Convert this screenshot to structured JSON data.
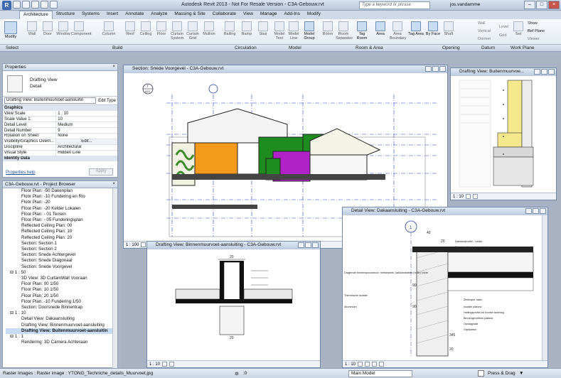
{
  "app": {
    "title": "Autodesk Revit 2013 - Not For Resale Version -    C3A-Gebouw.rvt",
    "search_placeholder": "Type a keyword or phrase",
    "user": "jos.vandamme"
  },
  "tabs": [
    "Architecture",
    "Structure",
    "Systems",
    "Insert",
    "Annotate",
    "Analyze",
    "Massing & Site",
    "Collaborate",
    "View",
    "Manage",
    "Add-Ins",
    "Modify"
  ],
  "ribbon": {
    "modify": "Modify",
    "tools": [
      {
        "label": "Wall",
        "on": false
      },
      {
        "label": "Door",
        "on": false
      },
      {
        "label": "Window",
        "on": false
      },
      {
        "label": "Component",
        "on": false
      },
      {
        "label": "Column",
        "on": false
      },
      {
        "label": "Roof",
        "on": false
      },
      {
        "label": "Ceiling",
        "on": false
      },
      {
        "label": "Floor",
        "on": false
      },
      {
        "label": "Curtain System",
        "on": false
      },
      {
        "label": "Curtain Grid",
        "on": false
      },
      {
        "label": "Mullion",
        "on": false
      },
      {
        "label": "Railing",
        "on": false
      },
      {
        "label": "Ramp",
        "on": false
      },
      {
        "label": "Stair",
        "on": false
      },
      {
        "label": "Model Text",
        "on": false
      },
      {
        "label": "Model Line",
        "on": false
      },
      {
        "label": "Model Group",
        "on": true
      },
      {
        "label": "Room",
        "on": false
      },
      {
        "label": "Room Separator",
        "on": false
      },
      {
        "label": "Tag Room",
        "on": true
      },
      {
        "label": "Area",
        "on": true
      },
      {
        "label": "Area Boundary",
        "on": false
      },
      {
        "label": "Tag Area",
        "on": true
      },
      {
        "label": "By Face",
        "on": true
      },
      {
        "label": "Shaft",
        "on": false
      }
    ],
    "opening_small": [
      "Wall",
      "Vertical",
      "Dormer"
    ],
    "datum_small": [
      "Level",
      "Grid"
    ],
    "workplane": [
      "Set",
      "Show",
      "Ref Plane",
      "Viewer"
    ],
    "panels": [
      "Select",
      "Build",
      "Circulation",
      "Model",
      "Room & Area",
      "Opening",
      "Datum",
      "Work Plane"
    ]
  },
  "properties": {
    "title": "Properties",
    "type_name": "Drafting View",
    "type_sub": "Detail",
    "selector": "Drafting View: Buitenmuurvoet-aansluitin",
    "edit_type": "Edit Type",
    "rows": [
      {
        "k": "Graphics",
        "v": "",
        "grp": true
      },
      {
        "k": "View Scale",
        "v": "1 : 10"
      },
      {
        "k": "Scale Value   1:",
        "v": "10"
      },
      {
        "k": "Detail Level",
        "v": "Medium"
      },
      {
        "k": "Detail Number",
        "v": "9"
      },
      {
        "k": "Rotation on Sheet",
        "v": "None"
      },
      {
        "k": "Visibility/Graphics Overri...",
        "v": "Edit..."
      },
      {
        "k": "Discipline",
        "v": "Architectural"
      },
      {
        "k": "Visual Style",
        "v": "Hidden Line"
      },
      {
        "k": "Identity Data",
        "v": "",
        "grp": true
      }
    ],
    "help": "Properties help",
    "apply": "Apply"
  },
  "browser": {
    "title": "C3A-Gebouw.rvt - Project Browser",
    "items": [
      {
        "t": "Floor Plan: -50 Dakenplan",
        "l": 2
      },
      {
        "t": "Floor Plan: -10 Fundering en Rio",
        "l": 2
      },
      {
        "t": "Floor Plan: -20",
        "l": 2
      },
      {
        "t": "Floor Plan: -20 Kelder Lokalen",
        "l": 2
      },
      {
        "t": "Floor Plan: - 01 Terrein",
        "l": 2
      },
      {
        "t": "Floor Plan: - 05 Funderingsplan",
        "l": 2
      },
      {
        "t": "Reflected Ceiling Plan: 00",
        "l": 2
      },
      {
        "t": "Reflected Ceiling Plan: 10",
        "l": 2
      },
      {
        "t": "Reflected Ceiling Plan: 20",
        "l": 2
      },
      {
        "t": "Section: Section 1",
        "l": 2
      },
      {
        "t": "Section: Section 2",
        "l": 2
      },
      {
        "t": "Section: Snede Achtergevel",
        "l": 2
      },
      {
        "t": "Section: Snede Diagonaal",
        "l": 2
      },
      {
        "t": "Section: Snede Voorgevel",
        "l": 2
      },
      {
        "t": "1 : 50",
        "l": 1
      },
      {
        "t": "3D View: 3D CurtainWall Vooraan",
        "l": 2
      },
      {
        "t": "Floor Plan: 00 1/50",
        "l": 2
      },
      {
        "t": "Floor Plan: 10 1/50",
        "l": 2
      },
      {
        "t": "Floor Plan: 20 1/50",
        "l": 2
      },
      {
        "t": "Floor Plan: -10 Fundering 1/50",
        "l": 2
      },
      {
        "t": "Section: Doorsnede Binnentrap",
        "l": 2
      },
      {
        "t": "1 : 10",
        "l": 1
      },
      {
        "t": "Detail View: Dakaansluiting",
        "l": 2
      },
      {
        "t": "Drafting View: Binnenmuurvoet-aansluiting",
        "l": 2
      },
      {
        "t": "Drafting View: Buitenmuurvoet-aansluitin",
        "l": 2,
        "sel": true
      },
      {
        "t": "1 : 1",
        "l": 1
      },
      {
        "t": "Rendering: 3D Camera Achteraan",
        "l": 2
      }
    ]
  },
  "views": {
    "section": {
      "title": "Section: Snede Voorgevel - C3A-Gebouw.rvt",
      "scale": "1 : 100",
      "marker": "7",
      "marker_sub": "A21"
    },
    "drafting_right": {
      "title": "Drafting View: Buitenmuurvoe...",
      "scale": "1 : 10"
    },
    "drafting_bottom": {
      "title": "Drafting View: Binnenmuurvoet-aansluiting - C3A-Gebouw.rvt",
      "scale": "1 : 10",
      "dims": [
        "20",
        "20"
      ]
    },
    "detail": {
      "title": "Detail View: Dakaansluiting - C3A-Gebouw.rvt",
      "scale": "1 : 10",
      "marker": "1",
      "dims": [
        "40",
        "20",
        "90",
        "90",
        "345",
        "20"
      ],
      "notes": [
        "Dakrandprofiel - Leider",
        "Dakafwerking bebouwd plat",
        "Dragende binnenspouwmuur, metselwerk, kalkzandsteen (holle) 14cm",
        "Thermische isolatie",
        "Aluminium",
        "Zinkkoper raam",
        "Isolatie plafond",
        "Hellingsprofiel en hoofse isolering",
        "Binnengevelblok plafond",
        "Opslagplaat",
        "Gipskarton"
      ]
    }
  },
  "status": {
    "left": "Raster Images : Raster image : YTONG_Techniche_details_Muurvoet.jpg",
    "zero": ":0",
    "model": "Main Model",
    "press_drag": "Press & Drag"
  },
  "colors": {
    "orange": "#f39a1c",
    "green": "#1e8c1e",
    "magenta": "#b021c8",
    "yellow": "#f4e78c",
    "accent": "#3e6bb0"
  }
}
